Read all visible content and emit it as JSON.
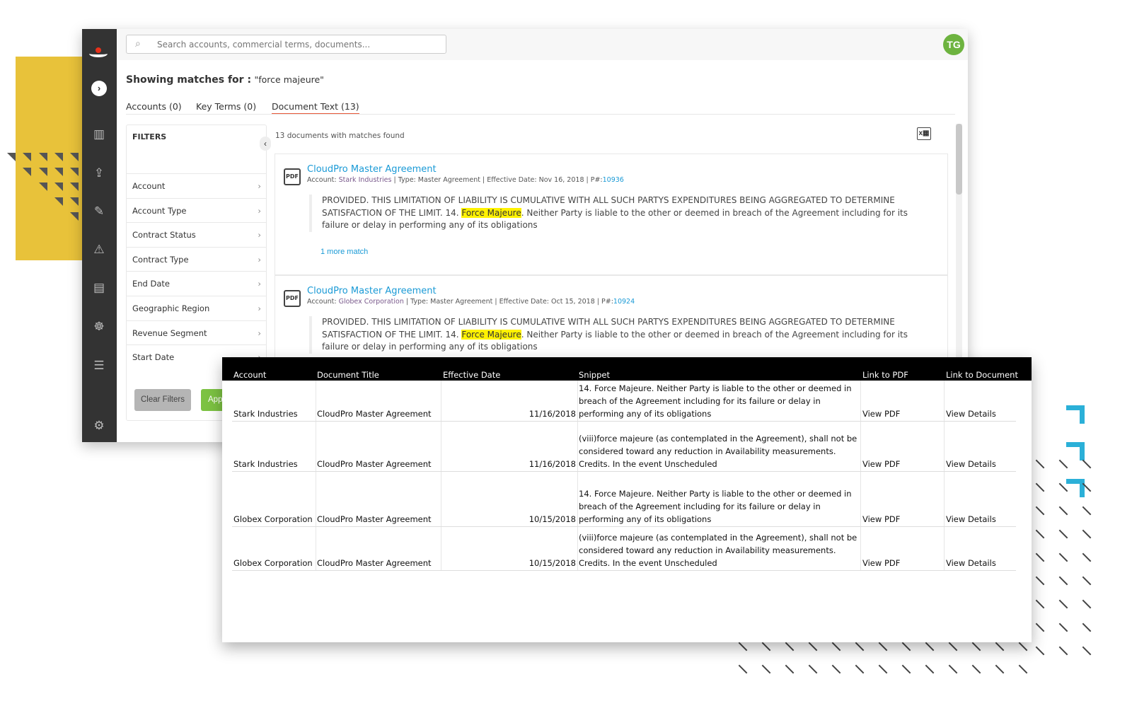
{
  "search": {
    "placeholder": "Search accounts, commercial terms, documents..."
  },
  "user": {
    "initials": "TG"
  },
  "heading": {
    "label": "Showing matches for :",
    "query": "\"force majeure\""
  },
  "tabs": [
    {
      "label": "Accounts (0)"
    },
    {
      "label": "Key Terms (0)"
    },
    {
      "label": "Document Text (13)",
      "active": true
    }
  ],
  "filters": {
    "title": "FILTERS",
    "items": [
      "Account",
      "Account Type",
      "Contract Status",
      "Contract Type",
      "End Date",
      "Geographic Region",
      "Revenue Segment",
      "Start Date"
    ],
    "clear_label": "Clear Filters",
    "apply_label": "Apply"
  },
  "results": {
    "count_text": "13 documents with matches found",
    "cards": [
      {
        "title": "CloudPro Master Agreement",
        "account_label": "Account: ",
        "account": "Stark Industries",
        "meta": " | Type: Master Agreement | Effective Date: Nov 16, 2018 | P#:",
        "pnum": "10936",
        "pre": "PROVIDED. THIS LIMITATION OF LIABILITY IS CUMULATIVE WITH ALL SUCH PARTYS EXPENDITURES BEING AGGREGATED TO DETERMINE SATISFACTION OF THE LIMIT. 14. ",
        "hl": "Force Majeure",
        "post": ". Neither Party is liable to the other or deemed in breach of the Agreement including for its failure or delay in performing any of its obligations",
        "more": "1 more match"
      },
      {
        "title": "CloudPro Master Agreement",
        "account_label": "Account: ",
        "account": "Globex Corporation",
        "meta": " | Type: Master Agreement | Effective Date: Oct 15, 2018 | P#:",
        "pnum": "10924",
        "pre": "PROVIDED. THIS LIMITATION OF LIABILITY IS CUMULATIVE WITH ALL SUCH PARTYS EXPENDITURES BEING AGGREGATED TO DETERMINE SATISFACTION OF THE LIMIT. 14. ",
        "hl": "Force Majeure",
        "post": ". Neither Party is liable to the other or deemed in breach of the Agreement including for its failure or delay in performing any of its obligations"
      }
    ]
  },
  "export": {
    "columns": [
      "Account",
      "Document Title",
      "Effective Date",
      "Snippet",
      "Link to PDF",
      "Link to Document"
    ],
    "rows": [
      [
        "Stark Industries",
        "CloudPro Master Agreement",
        "11/16/2018",
        "14. Force Majeure. Neither Party is liable to the other or deemed in breach of the Agreement including for its failure or delay in performing any of its obligations",
        "View PDF",
        "View Details"
      ],
      [
        "Stark Industries",
        "CloudPro Master Agreement",
        "11/16/2018",
        "(viii)force majeure (as contemplated in the Agreement), shall not be considered toward any reduction in Availability measurements. Credits. In the event Unscheduled",
        "View PDF",
        "View Details"
      ],
      [
        "Globex Corporation",
        "CloudPro Master Agreement",
        "10/15/2018",
        "14. Force Majeure. Neither Party is liable to the other or deemed in breach of the Agreement including for its failure or delay in performing any of its obligations",
        "View PDF",
        "View Details"
      ],
      [
        "Globex Corporation",
        "CloudPro Master Agreement",
        "10/15/2018",
        "(viii)force majeure (as contemplated in the Agreement), shall not be considered toward any reduction in Availability measurements. Credits. In the event Unscheduled",
        "View PDF",
        "View Details"
      ]
    ]
  },
  "colors": {
    "accent": "#1A9AD6",
    "tab_underline": "#E8593A",
    "avatar": "#6DB33F",
    "highlight": "#FFF200",
    "decor_yellow": "#E8C23A",
    "decor_blue": "#2BB0D8"
  }
}
